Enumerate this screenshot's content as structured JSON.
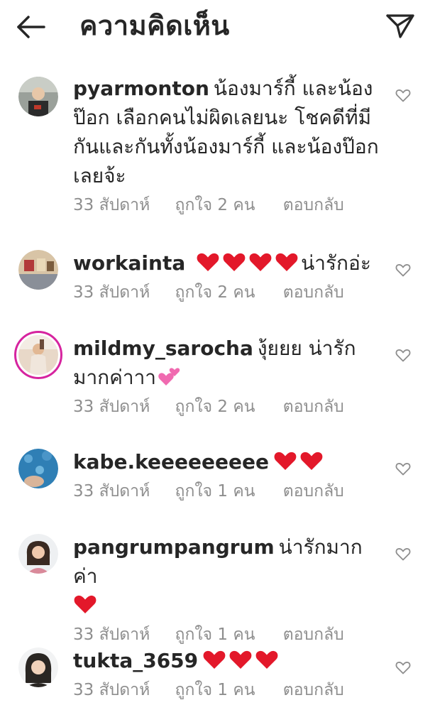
{
  "header": {
    "title": "ความคิดเห็น",
    "back_icon": "arrow-left-icon",
    "share_icon": "paper-plane-icon"
  },
  "comments": [
    {
      "username": "pyarmonton",
      "text": "น้องมาร์กี้ และน้องป๊อก เลือกคนไม่ผิดเลยนะ โชคดีที่มีกันและกันทั้งน้องมาร์กี้ และน้องป๊อก เลยจ้ะ",
      "hearts_before": 0,
      "time": "33 สัปดาห์",
      "likes": "ถูกใจ 2 คน",
      "reply": "ตอบกลับ"
    },
    {
      "username": "workainta",
      "text": "น่ารักอ่ะ",
      "hearts_before": 4,
      "time": "33 สัปดาห์",
      "likes": "ถูกใจ 2 คน",
      "reply": "ตอบกลับ"
    },
    {
      "username": "mildmy_sarocha",
      "text": "งุ้ยยย น่ารักมากค่าาา",
      "emoji_after": "two-hearts",
      "time": "33 สัปดาห์",
      "likes": "ถูกใจ 2 คน",
      "reply": "ตอบกลับ"
    },
    {
      "username": "kabe.keeeeeeeee",
      "text": "",
      "hearts_after": 2,
      "time": "33 สัปดาห์",
      "likes": "ถูกใจ 1 คน",
      "reply": "ตอบกลับ"
    },
    {
      "username": "pangrumpangrum",
      "text": "น่ารักมากค่า",
      "hearts_after": 1,
      "time": "33 สัปดาห์",
      "likes": "ถูกใจ 1 คน",
      "reply": "ตอบกลับ"
    },
    {
      "username": "tukta_3659",
      "text": "",
      "hearts_after": 3,
      "time": "33 สัปดาห์",
      "likes": "ถูกใจ 1 คน",
      "reply": "ตอบกลับ"
    }
  ],
  "colors": {
    "text": "#262626",
    "meta": "#8e8e8e",
    "heart_emoji": "#e3182a",
    "story_ring": "#d6249f"
  }
}
